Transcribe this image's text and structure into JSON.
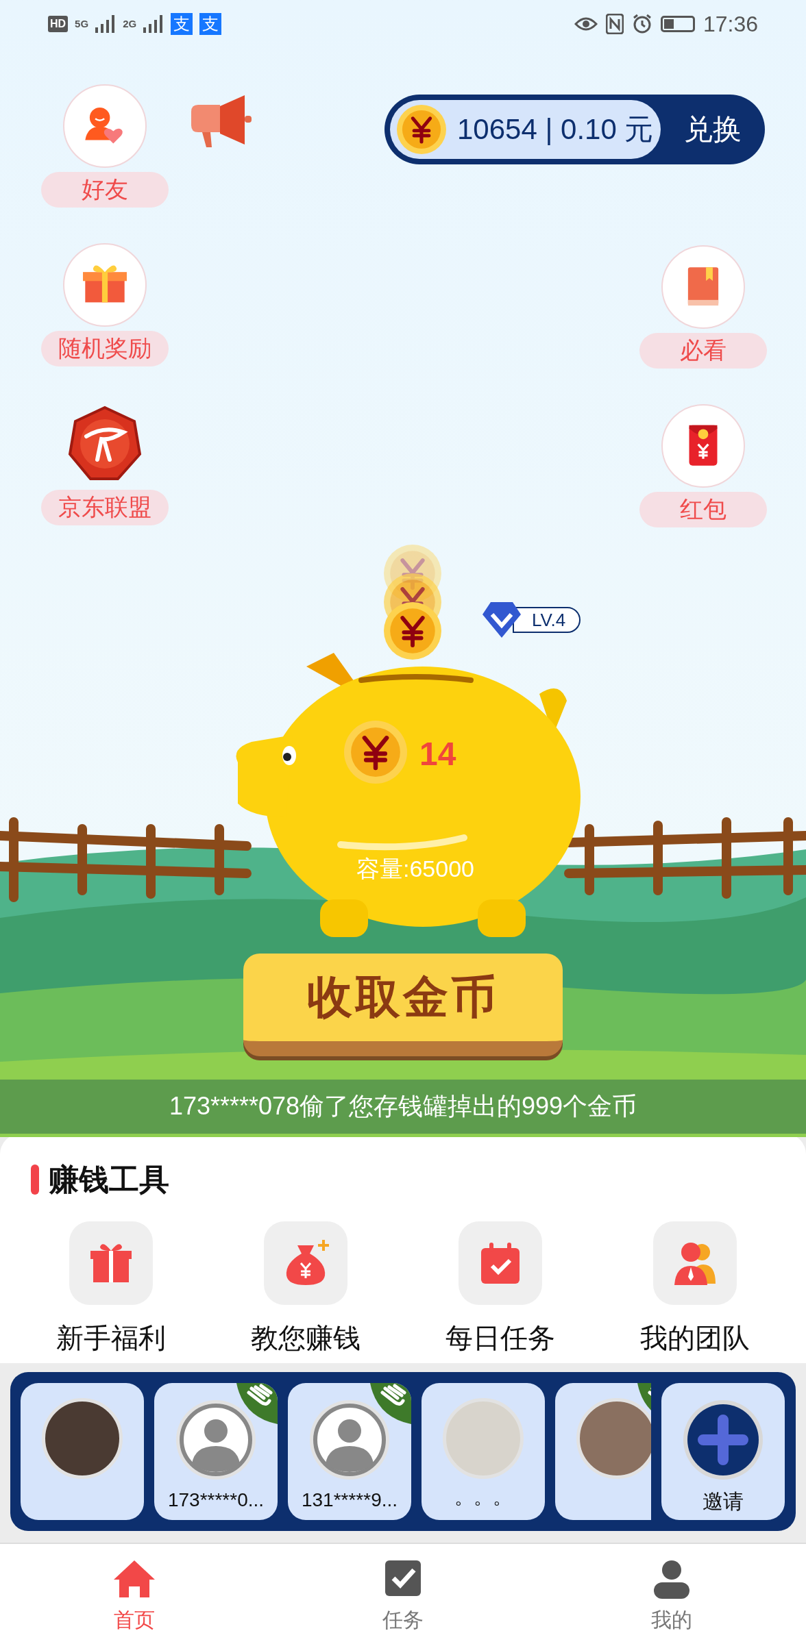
{
  "status_bar": {
    "left_labels": [
      "HD",
      "5G",
      "2G"
    ],
    "app_badges": [
      "支",
      "支"
    ],
    "time": "17:36"
  },
  "side_buttons": {
    "left": [
      {
        "kind": "friends",
        "label": "好友"
      },
      {
        "kind": "gift",
        "label": "随机奖励"
      },
      {
        "kind": "alliance",
        "label": "京东联盟"
      }
    ],
    "right": [
      {
        "kind": "book",
        "label": "必看"
      },
      {
        "kind": "red_packet",
        "label": "红包"
      }
    ]
  },
  "balance": {
    "amount": "10654 | 0.10 元",
    "exchange_button": "兑换"
  },
  "piggy_bank": {
    "level_badge": "LV.4",
    "coins": "14",
    "capacity": "容量:65000",
    "collect_button": "收取金币"
  },
  "ticker": "173*****078偷了您存钱罐掉出的999个金币",
  "tools": {
    "title": "赚钱工具",
    "items": [
      {
        "kind": "gift",
        "label": "新手福利"
      },
      {
        "kind": "money_bag",
        "label": "教您赚钱"
      },
      {
        "kind": "calendar",
        "label": "每日任务"
      },
      {
        "kind": "team",
        "label": "我的团队"
      }
    ]
  },
  "friends": {
    "items": [
      {
        "kind": "photo",
        "wave": false
      },
      {
        "kind": "default",
        "wave": true,
        "label": "173*****0..."
      },
      {
        "kind": "default",
        "wave": true,
        "label": "131*****9..."
      },
      {
        "kind": "photo",
        "wave": false,
        "label": "。。。"
      },
      {
        "kind": "photo",
        "wave": true
      }
    ],
    "invite": {
      "label": "邀请"
    }
  },
  "bottom_nav": [
    {
      "kind": "home",
      "label": "首页",
      "selected": true
    },
    {
      "kind": "tasks",
      "label": "任务",
      "selected": false
    },
    {
      "kind": "profile",
      "label": "我的",
      "selected": false
    }
  ]
}
